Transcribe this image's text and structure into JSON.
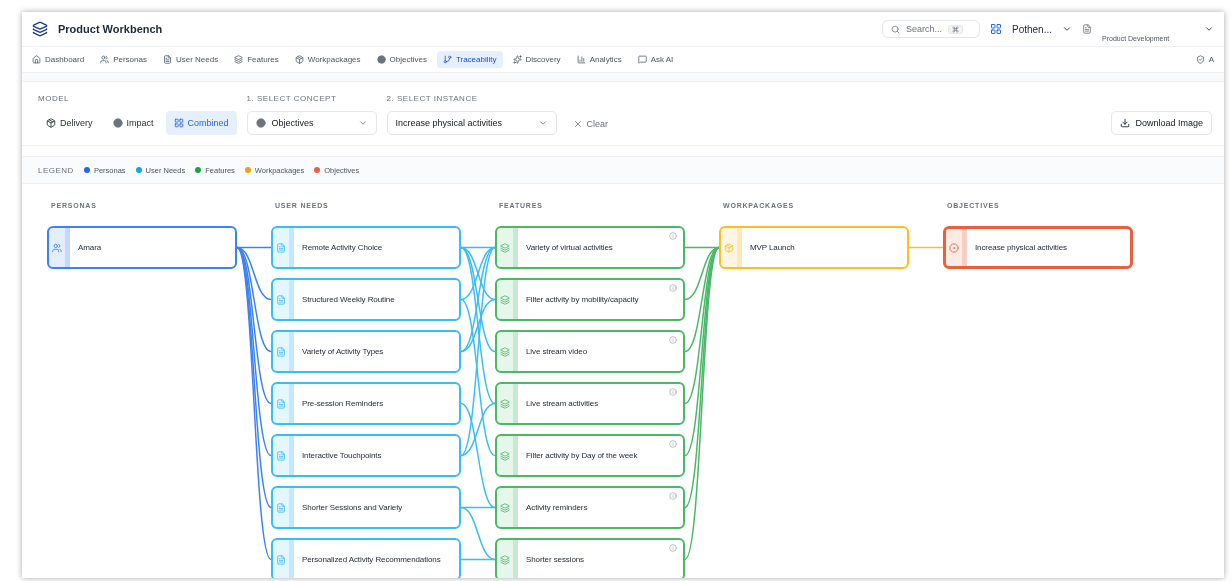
{
  "header": {
    "title": "Product Workbench",
    "search": {
      "placeholder": "Search..."
    },
    "workspace": "Pothen...",
    "project": "Product Development"
  },
  "tabs": [
    {
      "label": "Dashboard",
      "selected": false
    },
    {
      "label": "Personas",
      "selected": false
    },
    {
      "label": "User Needs",
      "selected": false
    },
    {
      "label": "Features",
      "selected": false
    },
    {
      "label": "Workpackages",
      "selected": false
    },
    {
      "label": "Objectives",
      "selected": false
    },
    {
      "label": "Traceability",
      "selected": true
    },
    {
      "label": "Discovery",
      "selected": false
    },
    {
      "label": "Analytics",
      "selected": false
    },
    {
      "label": "Ask AI",
      "selected": false
    },
    {
      "label": "A",
      "selected": false
    }
  ],
  "controls": {
    "model_label": "MODEL",
    "models": [
      {
        "label": "Delivery",
        "selected": false
      },
      {
        "label": "Impact",
        "selected": false
      },
      {
        "label": "Combined",
        "selected": true
      }
    ],
    "concept_label": "1. SELECT CONCEPT",
    "concept": "Objectives",
    "instance_label": "2. SELECT INSTANCE",
    "instance": "Increase physical activities",
    "clear": "Clear",
    "download": "Download Image"
  },
  "legend": {
    "label": "LEGEND",
    "items": [
      {
        "label": "Personas",
        "color": "#2563eb"
      },
      {
        "label": "User Needs",
        "color": "#0ea5e9"
      },
      {
        "label": "Features",
        "color": "#16a34a"
      },
      {
        "label": "Workpackages",
        "color": "#f59e0b"
      },
      {
        "label": "Objectives",
        "color": "#e8603c"
      }
    ]
  },
  "columns": [
    {
      "title": "PERSONAS",
      "color": "#3b82f6",
      "info": false,
      "nodes": [
        {
          "label": "Amara",
          "selected": false
        }
      ]
    },
    {
      "title": "USER NEEDS",
      "color": "#38bdf8",
      "info": false,
      "nodes": [
        {
          "label": "Remote Activity Choice",
          "selected": false
        },
        {
          "label": "Structured Weekly Routine",
          "selected": false
        },
        {
          "label": "Variety of Activity Types",
          "selected": false
        },
        {
          "label": "Pre-session Reminders",
          "selected": false
        },
        {
          "label": "Interactive Touchpoints",
          "selected": false
        },
        {
          "label": "Shorter Sessions and Variety",
          "selected": false
        },
        {
          "label": "Personalized Activity Recommendations",
          "selected": false
        }
      ]
    },
    {
      "title": "FEATURES",
      "color": "#4ab865",
      "info": true,
      "nodes": [
        {
          "label": "Variety of virtual activities",
          "selected": false
        },
        {
          "label": "Filter activity by mobility/capacity",
          "selected": false
        },
        {
          "label": "Live stream video",
          "selected": false
        },
        {
          "label": "Live stream activities",
          "selected": false
        },
        {
          "label": "Filter activity by Day of the week",
          "selected": false
        },
        {
          "label": "Activity reminders",
          "selected": false
        },
        {
          "label": "Shorter sessions",
          "selected": false
        }
      ]
    },
    {
      "title": "WORKPACKAGES",
      "color": "#fbbf24",
      "info": false,
      "nodes": [
        {
          "label": "MVP Launch",
          "selected": false
        }
      ]
    },
    {
      "title": "OBJECTIVES",
      "color": "#e8603c",
      "info": false,
      "nodes": [
        {
          "label": "Increase physical activities",
          "selected": true
        }
      ]
    }
  ]
}
